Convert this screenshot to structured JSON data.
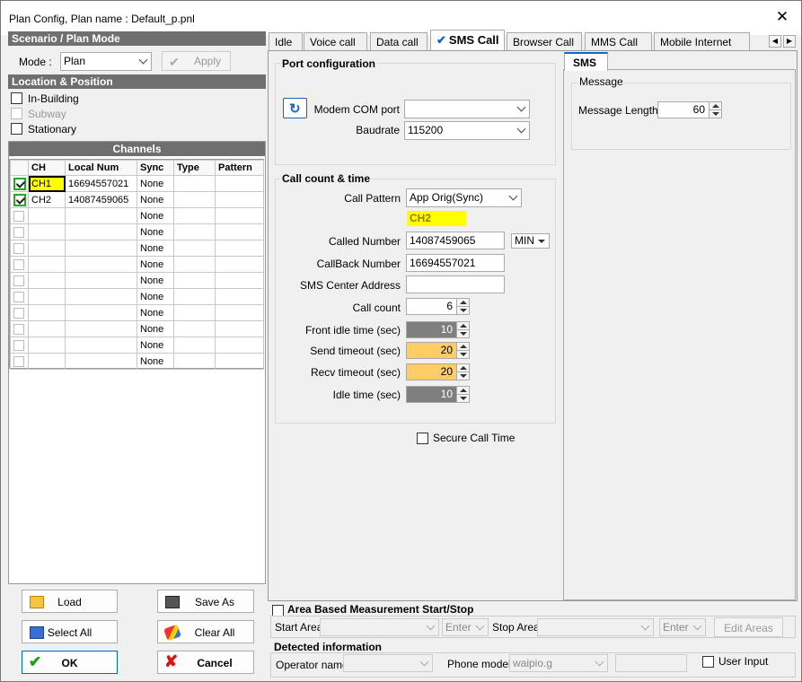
{
  "window": {
    "title": "Plan Config, Plan name : Default_p.pnl",
    "close_glyph": "✕"
  },
  "scenario": {
    "header": "Scenario / Plan Mode",
    "mode_label": "Mode :",
    "mode_value": "Plan",
    "apply_label": "Apply"
  },
  "location": {
    "header": "Location & Position",
    "options": [
      {
        "label": "In-Building",
        "enabled": true,
        "checked": false
      },
      {
        "label": "Subway",
        "enabled": false,
        "checked": false
      },
      {
        "label": "Stationary",
        "enabled": true,
        "checked": false
      }
    ]
  },
  "channels": {
    "header": "Channels",
    "columns": [
      "",
      "CH",
      "Local Num",
      "Sync",
      "Type",
      "Pattern"
    ],
    "rows": [
      {
        "checked": true,
        "ch": "CH1",
        "local_num": "16694557021",
        "sync": "None",
        "type": "",
        "pattern": "",
        "highlight": true
      },
      {
        "checked": true,
        "ch": "CH2",
        "local_num": "14087459065",
        "sync": "None",
        "type": "",
        "pattern": ""
      },
      {
        "checked": false,
        "ch": "",
        "local_num": "",
        "sync": "None",
        "type": "",
        "pattern": ""
      },
      {
        "checked": false,
        "ch": "",
        "local_num": "",
        "sync": "None",
        "type": "",
        "pattern": ""
      },
      {
        "checked": false,
        "ch": "",
        "local_num": "",
        "sync": "None",
        "type": "",
        "pattern": ""
      },
      {
        "checked": false,
        "ch": "",
        "local_num": "",
        "sync": "None",
        "type": "",
        "pattern": ""
      },
      {
        "checked": false,
        "ch": "",
        "local_num": "",
        "sync": "None",
        "type": "",
        "pattern": ""
      },
      {
        "checked": false,
        "ch": "",
        "local_num": "",
        "sync": "None",
        "type": "",
        "pattern": ""
      },
      {
        "checked": false,
        "ch": "",
        "local_num": "",
        "sync": "None",
        "type": "",
        "pattern": ""
      },
      {
        "checked": false,
        "ch": "",
        "local_num": "",
        "sync": "None",
        "type": "",
        "pattern": ""
      },
      {
        "checked": false,
        "ch": "",
        "local_num": "",
        "sync": "None",
        "type": "",
        "pattern": ""
      },
      {
        "checked": false,
        "ch": "",
        "local_num": "",
        "sync": "None",
        "type": "",
        "pattern": ""
      }
    ]
  },
  "buttons": {
    "load": "Load",
    "save_as": "Save As",
    "select_all": "Select All",
    "clear_all": "Clear All",
    "ok": "OK",
    "cancel": "Cancel"
  },
  "tabs": [
    {
      "label": "Idle",
      "active": false
    },
    {
      "label": "Voice call",
      "active": false
    },
    {
      "label": "Data call",
      "active": false
    },
    {
      "label": "SMS Call",
      "active": true
    },
    {
      "label": "Browser Call",
      "active": false
    },
    {
      "label": "MMS Call",
      "active": false
    },
    {
      "label": "Mobile Internet",
      "active": false
    }
  ],
  "port_config": {
    "title": "Port configuration",
    "modem_com_label": "Modem COM port",
    "modem_com_value": "",
    "baudrate_label": "Baudrate",
    "baudrate_value": "115200"
  },
  "call_count": {
    "title": "Call count & time",
    "call_pattern_label": "Call Pattern",
    "call_pattern_value": "App Orig(Sync)",
    "channel_indicator": "CH2",
    "called_number_label": "Called Number",
    "called_number_value": "14087459065",
    "called_unit": "MIN",
    "callback_number_label": "CallBack Number",
    "callback_number_value": "16694557021",
    "sms_center_label": "SMS Center Address",
    "sms_center_value": "",
    "call_count_label": "Call count",
    "call_count_value": "6",
    "front_idle_label": "Front idle time (sec)",
    "front_idle_value": "10",
    "send_timeout_label": "Send timeout (sec)",
    "send_timeout_value": "20",
    "recv_timeout_label": "Recv timeout (sec)",
    "recv_timeout_value": "20",
    "idle_time_label": "Idle time (sec)",
    "idle_time_value": "10",
    "secure_call_label": "Secure Call Time",
    "secure_call_checked": false
  },
  "sms_panel": {
    "tab": "SMS",
    "group": "Message",
    "length_label": "Message Length :",
    "length_value": "60"
  },
  "area": {
    "title": "Area Based Measurement Start/Stop",
    "start_label": "Start Area",
    "enter1": "Enter",
    "stop_label": "Stop Area",
    "enter2": "Enter",
    "edit_areas": "Edit Areas"
  },
  "detected": {
    "title": "Detected information",
    "operator_label": "Operator name",
    "operator_value": "",
    "phone_model_label": "Phone model",
    "phone_model_value": "waipio.g",
    "user_input_label": "User Input"
  },
  "colors": {
    "highlight_yellow": "#ffff00",
    "orange_field": "#ffcc66",
    "grey_field": "#7f7f7f",
    "section_header": "#6f6f6f",
    "check_green": "#22aa22",
    "tab_check_blue": "#1565c0"
  }
}
